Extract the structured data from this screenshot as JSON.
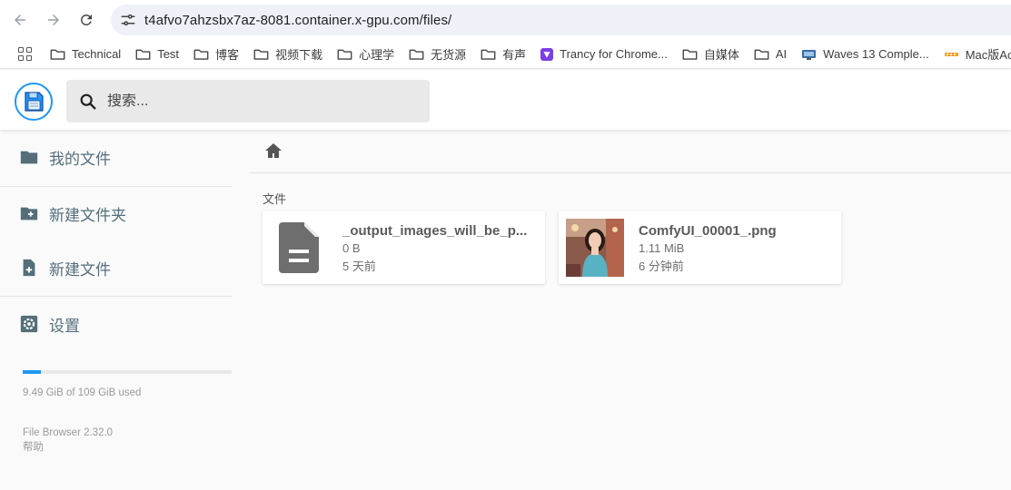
{
  "browser": {
    "url": "t4afvo7ahzsbx7az-8081.container.x-gpu.com/files/",
    "bookmarks": [
      {
        "label": "Technical",
        "icon": "folder-icon"
      },
      {
        "label": "Test",
        "icon": "folder-icon"
      },
      {
        "label": "博客",
        "icon": "folder-icon"
      },
      {
        "label": "视频下载",
        "icon": "folder-icon"
      },
      {
        "label": "心理学",
        "icon": "folder-icon"
      },
      {
        "label": "无货源",
        "icon": "folder-icon"
      },
      {
        "label": "有声",
        "icon": "folder-icon"
      },
      {
        "label": "Trancy for Chrome...",
        "icon": "trancy-icon",
        "color": "#7b3fe4"
      },
      {
        "label": "自媒体",
        "icon": "folder-icon"
      },
      {
        "label": "AI",
        "icon": "folder-icon"
      },
      {
        "label": "Waves 13 Comple...",
        "icon": "waves-icon",
        "color": "#3a6ea5"
      },
      {
        "label": "Mac版Ac",
        "icon": "macac-icon",
        "color": "#f0a020"
      }
    ]
  },
  "header": {
    "search_placeholder": "搜索..."
  },
  "sidebar": {
    "items": [
      {
        "label": "我的文件",
        "icon": "folder-icon"
      },
      {
        "label": "新建文件夹",
        "icon": "create-folder-icon"
      },
      {
        "label": "新建文件",
        "icon": "note-add-icon"
      },
      {
        "label": "设置",
        "icon": "settings-icon"
      }
    ],
    "usage_text": "9.49 GiB of 109 GiB used",
    "usage_fraction": 0.087,
    "version": "File Browser 2.32.0",
    "help": "帮助"
  },
  "main": {
    "section_title": "文件",
    "files": [
      {
        "name": "_output_images_will_be_p...",
        "size": "0 B",
        "modified": "5 天前",
        "icon": "file-icon"
      },
      {
        "name": "ComfyUI_00001_.png",
        "size": "1.11 MiB",
        "modified": "6 分钟前",
        "icon": "image-thumbnail"
      }
    ]
  },
  "colors": {
    "accent": "#2196f3",
    "sidebar_text": "#546e7a"
  }
}
